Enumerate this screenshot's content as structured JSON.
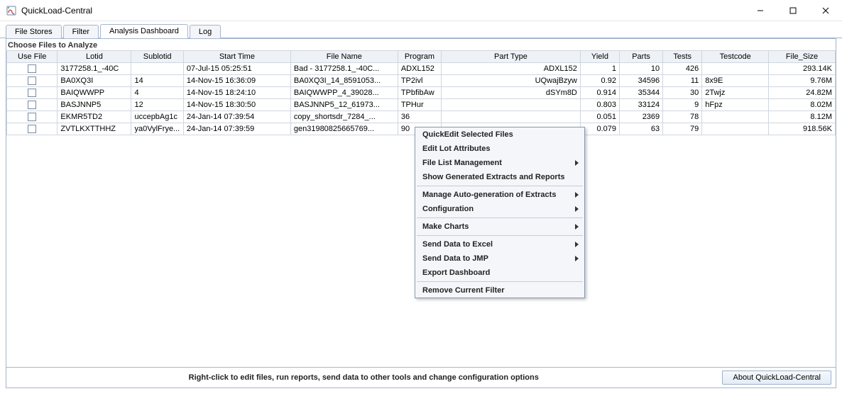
{
  "window": {
    "title": "QuickLoad-Central"
  },
  "tabs": [
    {
      "label": "File Stores"
    },
    {
      "label": "Filter"
    },
    {
      "label": "Analysis Dashboard"
    },
    {
      "label": "Log"
    }
  ],
  "active_tab": 2,
  "section_label": "Choose Files to Analyze",
  "columns": {
    "use_file": "Use File",
    "lotid": "Lotid",
    "sublotid": "Sublotid",
    "start_time": "Start Time",
    "file_name": "File Name",
    "program": "Program",
    "part_type": "Part Type",
    "yield": "Yield",
    "parts": "Parts",
    "tests": "Tests",
    "testcode": "Testcode",
    "file_size": "File_Size"
  },
  "rows": [
    {
      "lotid": "3177258.1_-40C",
      "sublotid": "",
      "start_time": "07-Jul-15 05:25:51",
      "file_name": "Bad - 3177258.1_-40C...",
      "program": "ADXL152",
      "part_type": "ADXL152",
      "yield": "1",
      "parts": "10",
      "tests": "426",
      "testcode": "",
      "file_size": "293.14K"
    },
    {
      "lotid": "BA0XQ3I",
      "sublotid": "14",
      "start_time": "14-Nov-15 16:36:09",
      "file_name": "BA0XQ3I_14_8591053...",
      "program": "TP2ivl",
      "part_type": "UQwajBzyw",
      "yield": "0.92",
      "parts": "34596",
      "tests": "11",
      "testcode": "8x9E",
      "file_size": "9.76M"
    },
    {
      "lotid": "BAIQWWPP",
      "sublotid": "4",
      "start_time": "14-Nov-15 18:24:10",
      "file_name": "BAIQWWPP_4_39028...",
      "program": "TPbfibAw",
      "part_type": "dSYm8D",
      "yield": "0.914",
      "parts": "35344",
      "tests": "30",
      "testcode": "2Twjz",
      "file_size": "24.82M"
    },
    {
      "lotid": "BASJNNP5",
      "sublotid": "12",
      "start_time": "14-Nov-15 18:30:50",
      "file_name": "BASJNNP5_12_61973...",
      "program": "TPHur",
      "part_type": "",
      "yield": "0.803",
      "parts": "33124",
      "tests": "9",
      "testcode": "hFpz",
      "file_size": "8.02M"
    },
    {
      "lotid": "EKMR5TD2",
      "sublotid": "uccepbAg1c",
      "start_time": "24-Jan-14 07:39:54",
      "file_name": "copy_shortsdr_7284_...",
      "program": "36",
      "part_type": "",
      "yield": "0.051",
      "parts": "2369",
      "tests": "78",
      "testcode": "",
      "file_size": "8.12M"
    },
    {
      "lotid": "ZVTLKXTTHHZ",
      "sublotid": "ya0VylFrye...",
      "start_time": "24-Jan-14 07:39:59",
      "file_name": "gen31980825665769...",
      "program": "90",
      "part_type": "",
      "yield": "0.079",
      "parts": "63",
      "tests": "79",
      "testcode": "",
      "file_size": "918.56K"
    }
  ],
  "context_menu": {
    "group1": [
      {
        "label": "QuickEdit Selected Files",
        "submenu": false
      },
      {
        "label": "Edit Lot Attributes",
        "submenu": false
      },
      {
        "label": "File List Management",
        "submenu": true
      },
      {
        "label": "Show Generated Extracts and Reports",
        "submenu": false
      }
    ],
    "group2": [
      {
        "label": "Manage Auto-generation of Extracts",
        "submenu": true
      },
      {
        "label": "Configuration",
        "submenu": true
      }
    ],
    "group3": [
      {
        "label": "Make Charts",
        "submenu": true
      }
    ],
    "group4": [
      {
        "label": "Send Data to Excel",
        "submenu": true
      },
      {
        "label": "Send Data to JMP",
        "submenu": true
      },
      {
        "label": "Export Dashboard",
        "submenu": false
      }
    ],
    "group5": [
      {
        "label": "Remove Current Filter",
        "submenu": false
      }
    ]
  },
  "footer": {
    "hint": "Right-click to edit files, run reports, send data to other tools and change configuration options",
    "about": "About QuickLoad-Central"
  }
}
